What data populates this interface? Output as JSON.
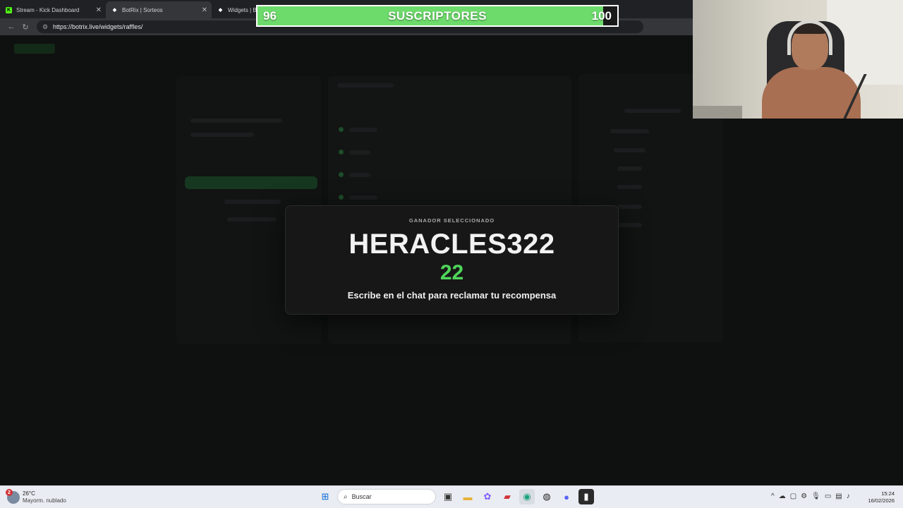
{
  "browser": {
    "tabs": [
      {
        "label": "Stream - Kick Dashboard",
        "icon": "kick-icon",
        "color": "#53fc18",
        "active": false
      },
      {
        "label": "BotRix | Sorteos",
        "icon": "botrix-icon",
        "color": "#ffffff",
        "active": true
      },
      {
        "label": "Widgets | Bl",
        "icon": "botrix-icon",
        "color": "#ffffff",
        "active": false
      }
    ],
    "url": "https://botrix.live/widgets/raffles/"
  },
  "subscriber_goal": {
    "current": "96",
    "title": "SUSCRIPTORES",
    "target": "100",
    "progress": 0.96,
    "fill_color": "#6ddb6b"
  },
  "winner_modal": {
    "kicker": "GANADOR SELECCIONADO",
    "winner": "HERACLES322",
    "number": "22",
    "message": "Escribe en el chat para reclamar tu recompensa",
    "number_color": "#4fd65a"
  },
  "taskbar": {
    "weather_badge": "2",
    "temperature": "26°C",
    "condition": "Mayorm. nublado",
    "search_placeholder": "Buscar",
    "time": "15:24",
    "date": "16/02/2026"
  }
}
